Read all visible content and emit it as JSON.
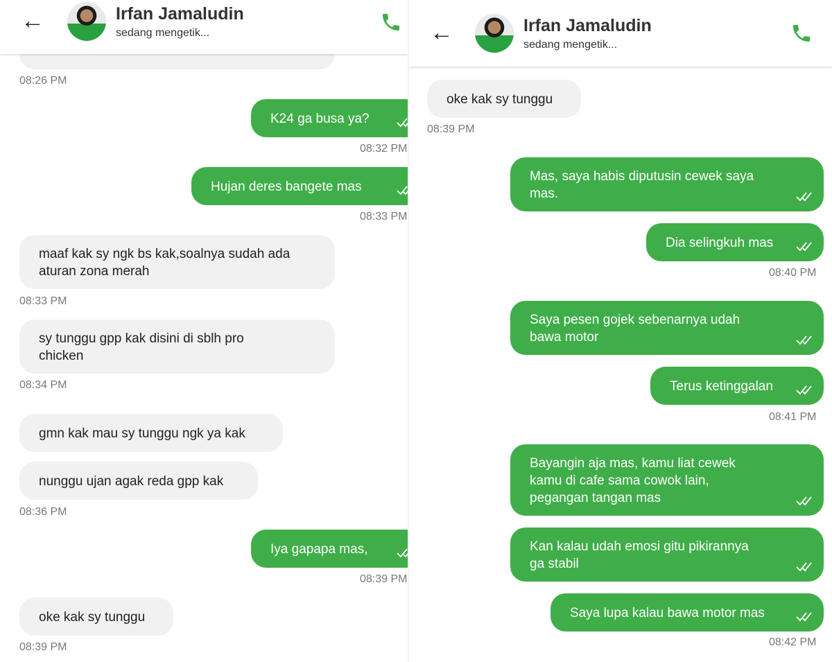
{
  "contact": {
    "name": "Irfan Jamaludin",
    "status": "sedang mengetik..."
  },
  "colors": {
    "outgoing_bubble": "#3fae49",
    "incoming_bubble": "#f1f1f1",
    "call_icon": "#3fae49"
  },
  "left_screen": {
    "truncated_time": "08:26 PM",
    "messages": [
      {
        "dir": "out",
        "text": "K24 ga busa ya?",
        "time": "08:32 PM"
      },
      {
        "dir": "out",
        "text": "Hujan deres bangete mas",
        "time": "08:33 PM"
      },
      {
        "dir": "in",
        "line1": "maaf kak sy ngk bs kak,soalnya sudah ada",
        "line2": "aturan zona merah",
        "time": "08:33 PM"
      },
      {
        "dir": "in",
        "line1": "sy tunggu gpp kak disini di sblh pro",
        "line2": "chicken",
        "time": "08:34 PM"
      },
      {
        "dir": "in",
        "text": "gmn kak mau sy tunggu ngk ya kak"
      },
      {
        "dir": "in",
        "text": "nunggu ujan agak reda gpp kak",
        "time": "08:36 PM"
      },
      {
        "dir": "out",
        "text": "Iya gapapa mas,",
        "time": "08:39 PM"
      },
      {
        "dir": "in",
        "text": "oke kak sy tunggu",
        "time": "08:39 PM"
      }
    ]
  },
  "right_screen": {
    "messages": [
      {
        "dir": "in",
        "text": "oke kak sy tunggu",
        "time": "08:39 PM"
      },
      {
        "dir": "out",
        "line1": "Mas, saya habis diputusin cewek saya",
        "line2": "mas."
      },
      {
        "dir": "out",
        "text": "Dia selingkuh mas",
        "time": "08:40 PM"
      },
      {
        "dir": "out",
        "line1": "Saya pesen gojek sebenarnya udah",
        "line2": "bawa motor"
      },
      {
        "dir": "out",
        "text": "Terus ketinggalan",
        "time": "08:41 PM"
      },
      {
        "dir": "out",
        "line1": "Bayangin aja mas, kamu liat cewek",
        "line2": "kamu di cafe sama cowok lain,",
        "line3": "pegangan tangan mas"
      },
      {
        "dir": "out",
        "line1": "Kan kalau udah emosi gitu pikirannya",
        "line2": "ga stabil"
      },
      {
        "dir": "out",
        "text": "Saya lupa kalau bawa motor mas",
        "time": "08:42 PM"
      }
    ]
  }
}
